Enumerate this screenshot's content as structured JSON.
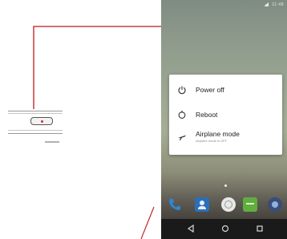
{
  "power_menu": {
    "items": [
      {
        "label": "Power off",
        "sublabel": ""
      },
      {
        "label": "Reboot",
        "sublabel": ""
      },
      {
        "label": "Airplane mode",
        "sublabel": "Airplane mode is OFF"
      }
    ]
  },
  "status_bar": {
    "time": "11:48"
  },
  "colors": {
    "callout_line": "#c0181e",
    "menu_bg": "#ffffff",
    "navbar": "#1a1a1a"
  },
  "icons": [
    "power-icon",
    "reboot-icon",
    "airplane-icon",
    "phone-icon",
    "contacts-icon",
    "browser-icon",
    "messaging-icon",
    "camera-icon",
    "back-icon",
    "home-icon",
    "recents-icon"
  ]
}
